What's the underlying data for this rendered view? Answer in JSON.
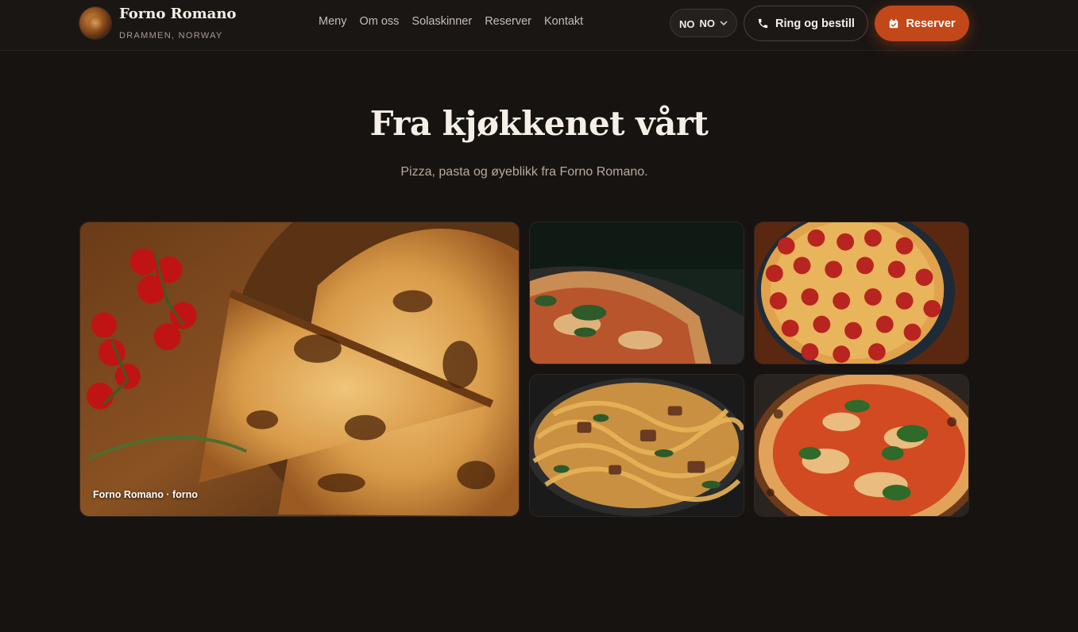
{
  "brand": {
    "name": "Forno Romano",
    "location": "DRAMMEN, NORWAY"
  },
  "nav": {
    "items": [
      "Meny",
      "Om oss",
      "Solaskinner",
      "Reserver",
      "Kontakt"
    ]
  },
  "language": {
    "flag_text": "NO",
    "selected": "NO"
  },
  "actions": {
    "call_label": "Ring og bestill",
    "reserve_label": "Reserver"
  },
  "gallery": {
    "title": "Fra kjøkkenet vårt",
    "subtitle": "Pizza, pasta og øyeblikk fra Forno Romano.",
    "featured_caption": "Forno Romano · forno",
    "photos": [
      "pizza-slices-board",
      "margherita-close-up",
      "pepperoni-pizza",
      "tagliatelle-pan",
      "basil-pizza"
    ]
  },
  "colors": {
    "background": "#171311",
    "accent": "#c2481a"
  }
}
